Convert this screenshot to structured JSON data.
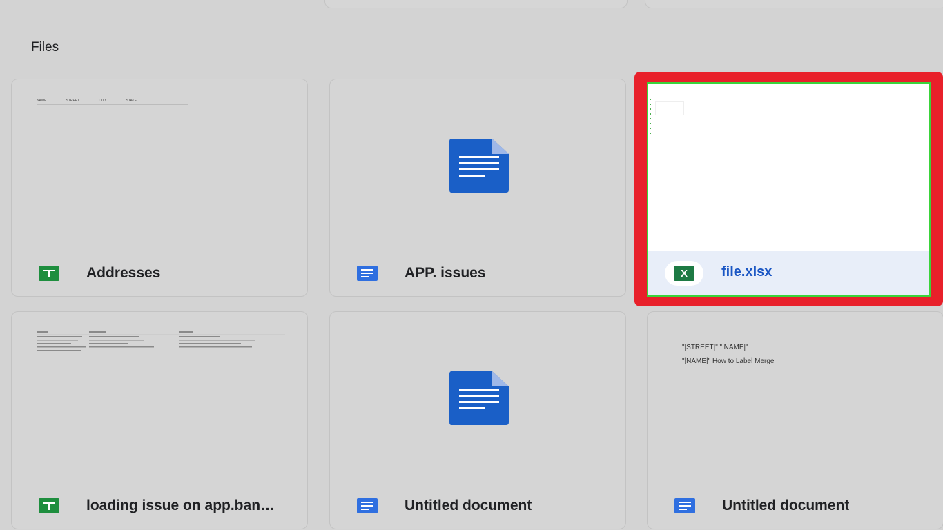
{
  "section": {
    "title": "Files"
  },
  "files": [
    {
      "name": "Addresses",
      "type": "sheet-icon",
      "preview_headers": [
        "NAME",
        "STREET",
        "CITY",
        "STATE"
      ]
    },
    {
      "name": "APP. issues",
      "type": "doc-icon"
    },
    {
      "name": "file.xlsx",
      "type": "excel-icon",
      "selected": true
    },
    {
      "name": "loading issue on app.ban…",
      "type": "sheet-icon"
    },
    {
      "name": "Untitled document",
      "type": "doc-icon"
    },
    {
      "name": "Untitled document",
      "type": "doc-icon",
      "preview_lines": [
        "\"|STREET|\" \"|NAME|\"",
        "\"|NAME|\" How to Label Merge"
      ]
    }
  ],
  "colors": {
    "highlight": "#e8202a",
    "sheets_green": "#1e8e3e",
    "docs_blue": "#2f6fe0",
    "link_blue": "#1a56c4"
  }
}
